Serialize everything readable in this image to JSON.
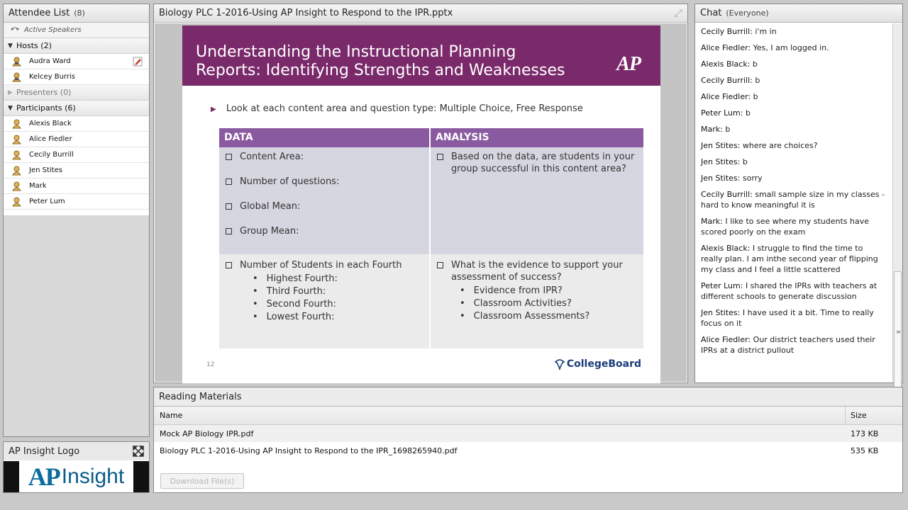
{
  "attendee_panel": {
    "title": "Attendee List",
    "count": "(8)",
    "active_speakers": "Active Speakers",
    "hosts_label": "Hosts (2)",
    "hosts": [
      "Audra Ward",
      "Kelcey Burris"
    ],
    "presenters_label": "Presenters (0)",
    "participants_label": "Participants (6)",
    "participants": [
      "Alexis  Black",
      "Alice Fiedler",
      "Cecily Burrill",
      "Jen Stites",
      "Mark",
      "Peter Lum"
    ]
  },
  "logo_panel": {
    "title": "AP Insight Logo",
    "logo_ap": "AP",
    "logo_word": "Insight"
  },
  "presentation": {
    "title": "Biology PLC 1-2016-Using AP Insight to Respond to the IPR.pptx",
    "slide": {
      "heading_line1": "Understanding the Instructional Planning",
      "heading_line2": "Reports: Identifying Strengths and Weaknesses",
      "ap_mark": "AP",
      "bullet": "Look at each content area and question type: Multiple Choice, Free Response",
      "col_data": "DATA",
      "col_analysis": "ANALYSIS",
      "data_items": [
        "Content Area:",
        "Number of questions:",
        "Global Mean:",
        "Group Mean:"
      ],
      "analysis_q1": "Based on the data, are students in your group successful in this content area?",
      "fourth_label": "Number of Students in each Fourth",
      "fourths": [
        "Highest Fourth:",
        "Third Fourth:",
        "Second Fourth:",
        "Lowest Fourth:"
      ],
      "analysis_q2": "What is the evidence to support your assessment of success?",
      "evidence": [
        "Evidence from  IPR?",
        "Classroom Activities?",
        "Classroom Assessments?"
      ],
      "page_number": "12",
      "brand": "CollegeBoard"
    }
  },
  "chat": {
    "title": "Chat",
    "scope": "(Everyone)",
    "messages": [
      {
        "from": "Cecily Burrill:",
        "text": "i'm in"
      },
      {
        "from": "Alice Fiedler:",
        "text": "Yes, I am logged in."
      },
      {
        "from": "Alexis  Black:",
        "text": "b"
      },
      {
        "from": "Cecily Burrill:",
        "text": "b"
      },
      {
        "from": "Alice Fiedler:",
        "text": "b"
      },
      {
        "from": "Peter Lum:",
        "text": "b"
      },
      {
        "from": "Mark:",
        "text": "b"
      },
      {
        "from": "Jen Stites:",
        "text": "where are choices?"
      },
      {
        "from": "Jen Stites:",
        "text": "b"
      },
      {
        "from": "Jen Stites:",
        "text": "sorry"
      },
      {
        "from": "Cecily Burrill:",
        "text": "small sample size in my classes - hard to know meaningful it is"
      },
      {
        "from": "Mark:",
        "text": "I like to see where my students have scored poorly on the exam"
      },
      {
        "from": "Alexis  Black:",
        "text": "I struggle to find the time to really plan.  I am inthe second year of flipping my class and I feel a little scattered"
      },
      {
        "from": "Peter Lum:",
        "text": "I shared the IPRs with teachers at different schools to generate discussion"
      },
      {
        "from": "Jen Stites:",
        "text": "I have used it a bit.  Time to really focus on it"
      },
      {
        "from": "Alice Fiedler:",
        "text": "Our district teachers used their IPRs at a district pullout"
      }
    ]
  },
  "reading": {
    "title": "Reading Materials",
    "col_name": "Name",
    "col_size": "Size",
    "files": [
      {
        "name": "Mock AP Biology IPR.pdf",
        "size": "173 KB"
      },
      {
        "name": "Biology PLC 1-2016-Using AP Insight to Respond to the IPR_1698265940.pdf",
        "size": "535 KB"
      }
    ],
    "download_label": "Download File(s)"
  }
}
